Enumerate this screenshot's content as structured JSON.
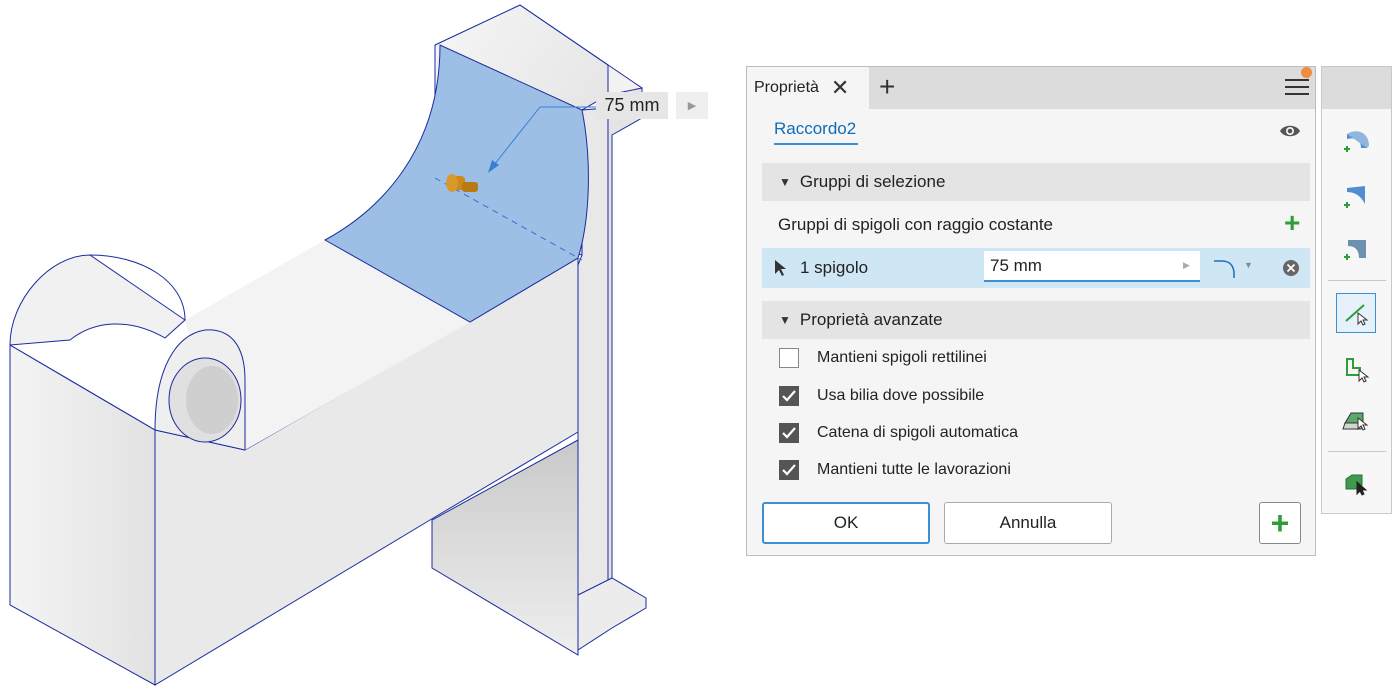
{
  "viewport": {
    "dimension_value": "75 mm",
    "model_color": "#ededed",
    "selection_color": "#9dbfe6",
    "edge_color": "#1a2ba0"
  },
  "panel": {
    "tab_label": "Proprietà",
    "feature_name": "Raccordo2",
    "sections": {
      "selection": "Gruppi di selezione",
      "advanced": "Proprietà avanzate"
    },
    "edge_group_label": "Gruppi di spigoli con raggio costante",
    "edge_row": {
      "label": "1 spigolo",
      "radius": "75 mm"
    },
    "options": [
      {
        "label": "Mantieni spigoli rettilinei",
        "checked": false
      },
      {
        "label": "Usa bilia dove possibile",
        "checked": true
      },
      {
        "label": "Catena di spigoli automatica",
        "checked": true
      },
      {
        "label": "Mantieni tutte le lavorazioni",
        "checked": true
      }
    ],
    "buttons": {
      "ok": "OK",
      "cancel": "Annulla"
    },
    "icons": [
      "close-icon",
      "plus-icon",
      "menu-icon",
      "eye-icon",
      "cursor-icon",
      "fillet-type-icon",
      "remove-icon"
    ]
  },
  "mini_toolbar": {
    "icons": [
      "constant-fillet-icon",
      "variable-fillet-icon",
      "setback-fillet-icon",
      "edge-select-icon",
      "loop-select-icon",
      "feature-select-icon",
      "solid-select-icon"
    ],
    "accent": "#3a8fd6"
  }
}
